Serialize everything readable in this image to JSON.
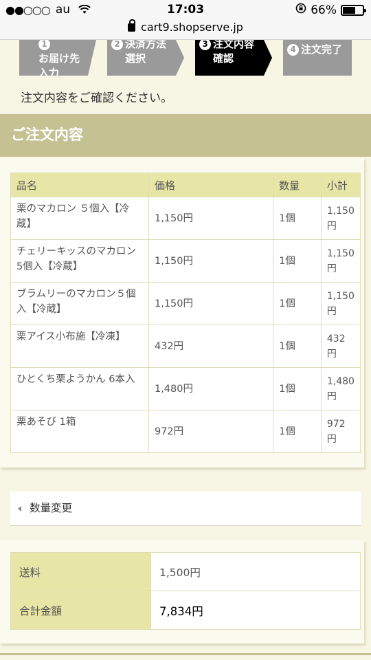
{
  "status_bar": {
    "signal": "●●○○○",
    "carrier": "au",
    "time": "17:03",
    "battery_percent": "66%",
    "battery_level": 0.66
  },
  "browser": {
    "url": "cart9.shopserve.jp"
  },
  "steps": [
    {
      "num": "1",
      "label_line1": "お届け先",
      "label_line2": "入力",
      "state": "done"
    },
    {
      "num": "2",
      "label_line1": "決済方法",
      "label_line2": "選択",
      "state": "done"
    },
    {
      "num": "3",
      "label_line1": "注文内容",
      "label_line2": "確認",
      "state": "active"
    },
    {
      "num": "4",
      "label_line1": "注文完了",
      "label_line2": "",
      "state": "pending"
    }
  ],
  "intro_text": "注文内容をご確認ください。",
  "section_title": "ご注文内容",
  "table": {
    "headers": {
      "name": "品名",
      "price": "価格",
      "qty": "数量",
      "subtotal": "小計"
    },
    "rows": [
      {
        "name": "栗のマカロン ５個入【冷蔵】",
        "price": "1,150円",
        "qty": "1個",
        "subtotal": "1,150円"
      },
      {
        "name": "チェリーキッスのマカロン 5個入【冷蔵】",
        "price": "1,150円",
        "qty": "1個",
        "subtotal": "1,150円"
      },
      {
        "name": "ブラムリーのマカロン５個入【冷蔵】",
        "price": "1,150円",
        "qty": "1個",
        "subtotal": "1,150円"
      },
      {
        "name": "栗アイス小布施【冷凍】",
        "price": "432円",
        "qty": "1個",
        "subtotal": "432円"
      },
      {
        "name": "ひとくち栗ようかん 6本入",
        "price": "1,480円",
        "qty": "1個",
        "subtotal": "1,480円"
      },
      {
        "name": "栗あそび 1箱",
        "price": "972円",
        "qty": "1個",
        "subtotal": "972円"
      }
    ]
  },
  "back_link": "数量変更",
  "summary": {
    "shipping_label": "送料",
    "shipping_value": "1,500円",
    "total_label": "合計金額",
    "total_value": "7,834円"
  },
  "colors": {
    "page_bg": "#f7f5e3",
    "section_head": "#c6c193",
    "table_head": "#e8e6a6",
    "step_done": "#9a9a9a",
    "step_active": "#000000"
  }
}
